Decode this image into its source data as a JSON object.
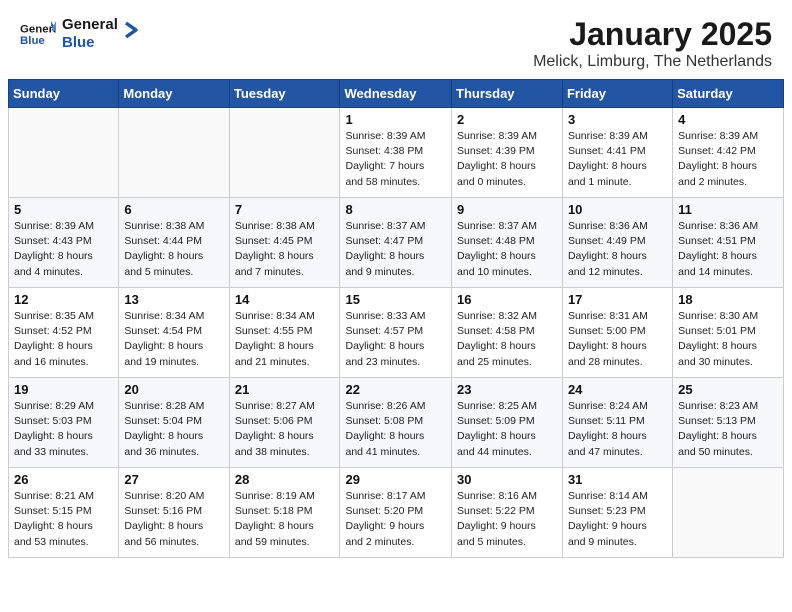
{
  "header": {
    "logo_line1": "General",
    "logo_line2": "Blue",
    "main_title": "January 2025",
    "subtitle": "Melick, Limburg, The Netherlands"
  },
  "weekdays": [
    "Sunday",
    "Monday",
    "Tuesday",
    "Wednesday",
    "Thursday",
    "Friday",
    "Saturday"
  ],
  "weeks": [
    [
      {
        "day": "",
        "info": ""
      },
      {
        "day": "",
        "info": ""
      },
      {
        "day": "",
        "info": ""
      },
      {
        "day": "1",
        "info": "Sunrise: 8:39 AM\nSunset: 4:38 PM\nDaylight: 7 hours\nand 58 minutes."
      },
      {
        "day": "2",
        "info": "Sunrise: 8:39 AM\nSunset: 4:39 PM\nDaylight: 8 hours\nand 0 minutes."
      },
      {
        "day": "3",
        "info": "Sunrise: 8:39 AM\nSunset: 4:41 PM\nDaylight: 8 hours\nand 1 minute."
      },
      {
        "day": "4",
        "info": "Sunrise: 8:39 AM\nSunset: 4:42 PM\nDaylight: 8 hours\nand 2 minutes."
      }
    ],
    [
      {
        "day": "5",
        "info": "Sunrise: 8:39 AM\nSunset: 4:43 PM\nDaylight: 8 hours\nand 4 minutes."
      },
      {
        "day": "6",
        "info": "Sunrise: 8:38 AM\nSunset: 4:44 PM\nDaylight: 8 hours\nand 5 minutes."
      },
      {
        "day": "7",
        "info": "Sunrise: 8:38 AM\nSunset: 4:45 PM\nDaylight: 8 hours\nand 7 minutes."
      },
      {
        "day": "8",
        "info": "Sunrise: 8:37 AM\nSunset: 4:47 PM\nDaylight: 8 hours\nand 9 minutes."
      },
      {
        "day": "9",
        "info": "Sunrise: 8:37 AM\nSunset: 4:48 PM\nDaylight: 8 hours\nand 10 minutes."
      },
      {
        "day": "10",
        "info": "Sunrise: 8:36 AM\nSunset: 4:49 PM\nDaylight: 8 hours\nand 12 minutes."
      },
      {
        "day": "11",
        "info": "Sunrise: 8:36 AM\nSunset: 4:51 PM\nDaylight: 8 hours\nand 14 minutes."
      }
    ],
    [
      {
        "day": "12",
        "info": "Sunrise: 8:35 AM\nSunset: 4:52 PM\nDaylight: 8 hours\nand 16 minutes."
      },
      {
        "day": "13",
        "info": "Sunrise: 8:34 AM\nSunset: 4:54 PM\nDaylight: 8 hours\nand 19 minutes."
      },
      {
        "day": "14",
        "info": "Sunrise: 8:34 AM\nSunset: 4:55 PM\nDaylight: 8 hours\nand 21 minutes."
      },
      {
        "day": "15",
        "info": "Sunrise: 8:33 AM\nSunset: 4:57 PM\nDaylight: 8 hours\nand 23 minutes."
      },
      {
        "day": "16",
        "info": "Sunrise: 8:32 AM\nSunset: 4:58 PM\nDaylight: 8 hours\nand 25 minutes."
      },
      {
        "day": "17",
        "info": "Sunrise: 8:31 AM\nSunset: 5:00 PM\nDaylight: 8 hours\nand 28 minutes."
      },
      {
        "day": "18",
        "info": "Sunrise: 8:30 AM\nSunset: 5:01 PM\nDaylight: 8 hours\nand 30 minutes."
      }
    ],
    [
      {
        "day": "19",
        "info": "Sunrise: 8:29 AM\nSunset: 5:03 PM\nDaylight: 8 hours\nand 33 minutes."
      },
      {
        "day": "20",
        "info": "Sunrise: 8:28 AM\nSunset: 5:04 PM\nDaylight: 8 hours\nand 36 minutes."
      },
      {
        "day": "21",
        "info": "Sunrise: 8:27 AM\nSunset: 5:06 PM\nDaylight: 8 hours\nand 38 minutes."
      },
      {
        "day": "22",
        "info": "Sunrise: 8:26 AM\nSunset: 5:08 PM\nDaylight: 8 hours\nand 41 minutes."
      },
      {
        "day": "23",
        "info": "Sunrise: 8:25 AM\nSunset: 5:09 PM\nDaylight: 8 hours\nand 44 minutes."
      },
      {
        "day": "24",
        "info": "Sunrise: 8:24 AM\nSunset: 5:11 PM\nDaylight: 8 hours\nand 47 minutes."
      },
      {
        "day": "25",
        "info": "Sunrise: 8:23 AM\nSunset: 5:13 PM\nDaylight: 8 hours\nand 50 minutes."
      }
    ],
    [
      {
        "day": "26",
        "info": "Sunrise: 8:21 AM\nSunset: 5:15 PM\nDaylight: 8 hours\nand 53 minutes."
      },
      {
        "day": "27",
        "info": "Sunrise: 8:20 AM\nSunset: 5:16 PM\nDaylight: 8 hours\nand 56 minutes."
      },
      {
        "day": "28",
        "info": "Sunrise: 8:19 AM\nSunset: 5:18 PM\nDaylight: 8 hours\nand 59 minutes."
      },
      {
        "day": "29",
        "info": "Sunrise: 8:17 AM\nSunset: 5:20 PM\nDaylight: 9 hours\nand 2 minutes."
      },
      {
        "day": "30",
        "info": "Sunrise: 8:16 AM\nSunset: 5:22 PM\nDaylight: 9 hours\nand 5 minutes."
      },
      {
        "day": "31",
        "info": "Sunrise: 8:14 AM\nSunset: 5:23 PM\nDaylight: 9 hours\nand 9 minutes."
      },
      {
        "day": "",
        "info": ""
      }
    ]
  ]
}
